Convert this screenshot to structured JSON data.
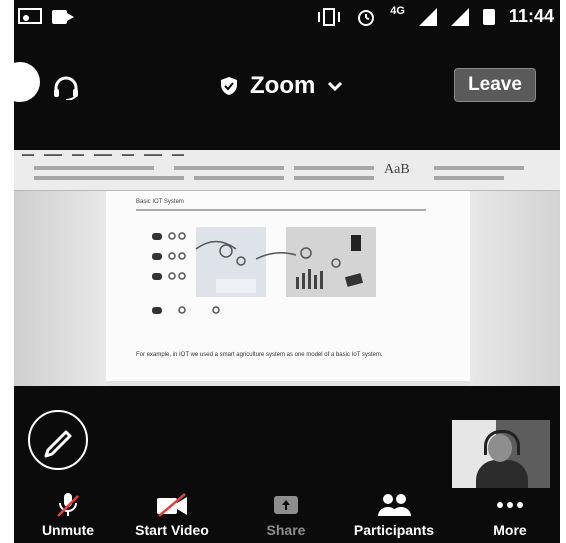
{
  "status_bar": {
    "time": "11:44",
    "network": "4G"
  },
  "header": {
    "title": "Zoom",
    "leave_label": "Leave"
  },
  "shared_content": {
    "ribbon_text": "AaB",
    "page_heading": "Basic IOT System",
    "caption": "For example, in IOT we used a smart agriculture system as one model of a basic IoT system."
  },
  "toolbar": {
    "items": [
      {
        "label": "Unmute",
        "icon": "microphone-muted-icon"
      },
      {
        "label": "Start Video",
        "icon": "video-off-icon"
      },
      {
        "label": "Share",
        "icon": "share-arrow-icon"
      },
      {
        "label": "Participants",
        "icon": "participants-icon"
      },
      {
        "label": "More",
        "icon": "more-dots-icon"
      }
    ]
  },
  "colors": {
    "background": "#0b0b0b",
    "leave_button": "#5a5a5a",
    "dim_text": "#8e8e8e"
  }
}
